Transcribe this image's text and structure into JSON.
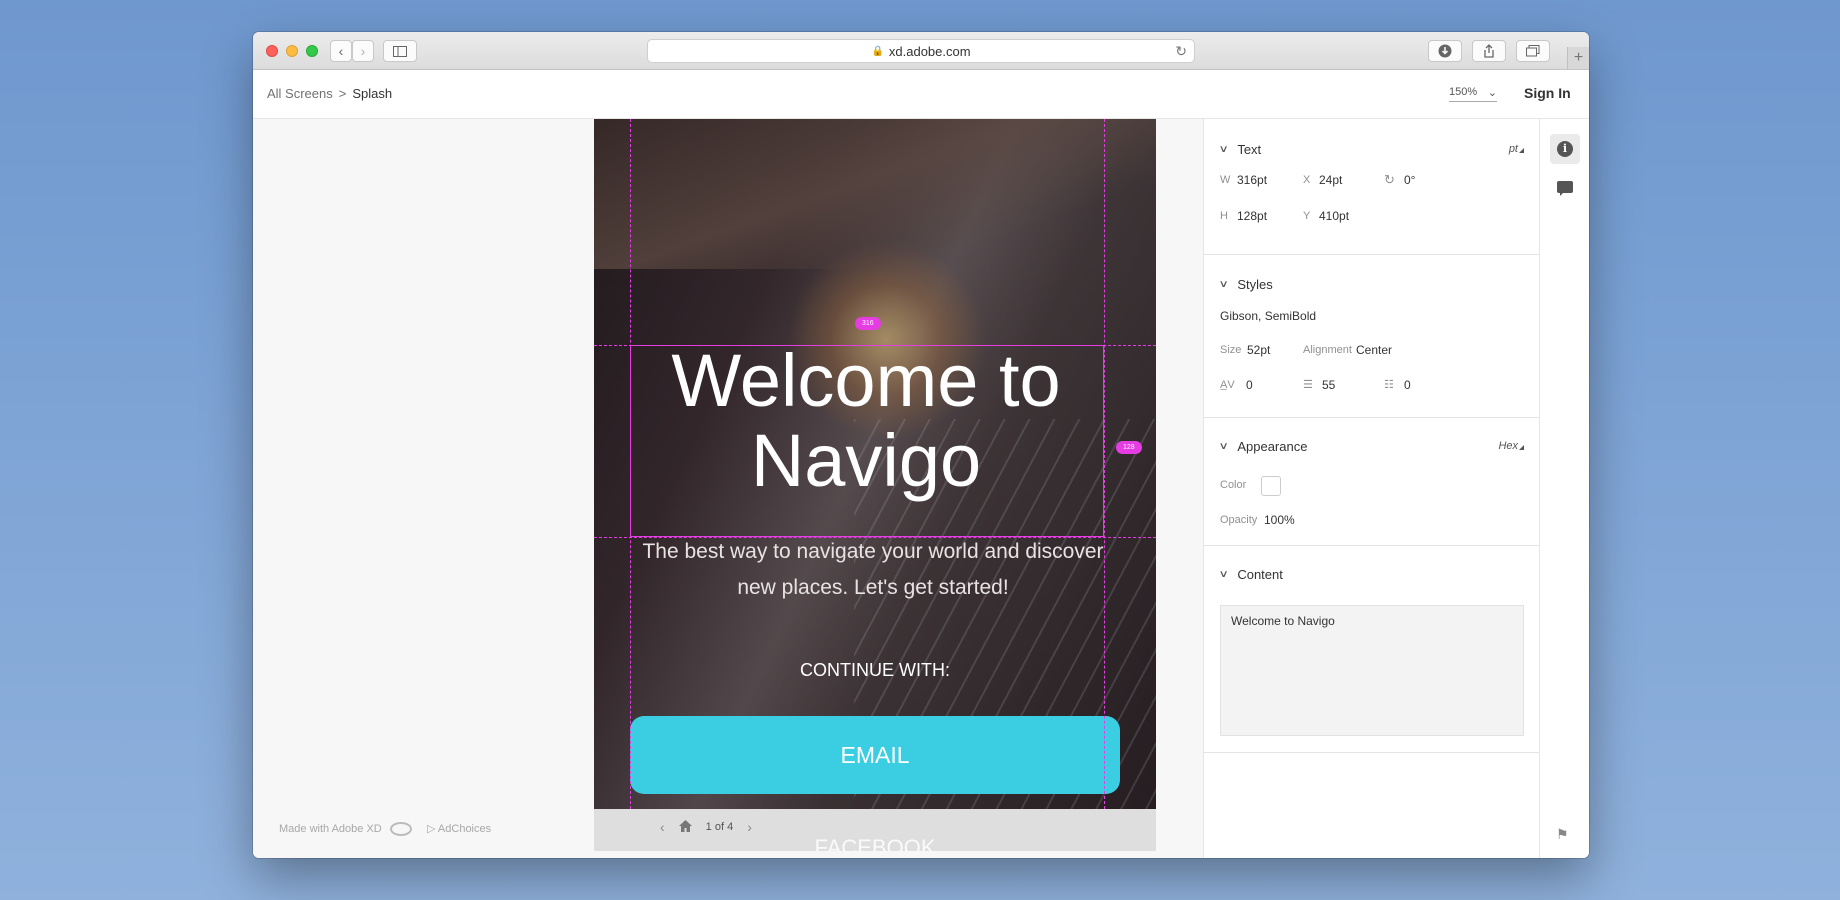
{
  "browser": {
    "url": "xd.adobe.com",
    "icons": [
      "back-icon",
      "forward-icon",
      "sidebar-icon",
      "lock-icon",
      "reload-icon",
      "download-icon",
      "share-icon",
      "tabs-icon",
      "new-tab-icon"
    ]
  },
  "header": {
    "breadcrumb_root": "All Screens",
    "breadcrumb_separator": ">",
    "breadcrumb_current": "Splash",
    "zoom": "150%",
    "sign_in": "Sign In"
  },
  "artboard": {
    "title": "Welcome to Navigo",
    "subtitle": "The best way to navigate your world and discover new places. Let's get started!",
    "continue_label": "CONTINUE WITH:",
    "email_button": "EMAIL",
    "facebook_button": "FACEBOOK",
    "guide_width_label": "316",
    "guide_height_label": "128",
    "accent_color": "#3bcde1",
    "guide_color": "#e53ce4"
  },
  "pager": {
    "label": "1 of 4"
  },
  "footer": {
    "made_with": "Made with Adobe XD",
    "adchoices": "AdChoices"
  },
  "panel": {
    "text": {
      "title": "Text",
      "unit": "pt",
      "w_label": "W",
      "w_value": "316pt",
      "x_label": "X",
      "x_value": "24pt",
      "rotation_value": "0°",
      "h_label": "H",
      "h_value": "128pt",
      "y_label": "Y",
      "y_value": "410pt"
    },
    "styles": {
      "title": "Styles",
      "font": "Gibson, SemiBold",
      "size_label": "Size",
      "size_value": "52pt",
      "alignment_label": "Alignment",
      "alignment_value": "Center",
      "char_spacing_value": "0",
      "line_spacing_value": "55",
      "paragraph_spacing_value": "0"
    },
    "appearance": {
      "title": "Appearance",
      "mode": "Hex",
      "color_label": "Color",
      "color_value": "#ffffff",
      "opacity_label": "Opacity",
      "opacity_value": "100%"
    },
    "content": {
      "title": "Content",
      "text": "Welcome to Navigo"
    }
  }
}
